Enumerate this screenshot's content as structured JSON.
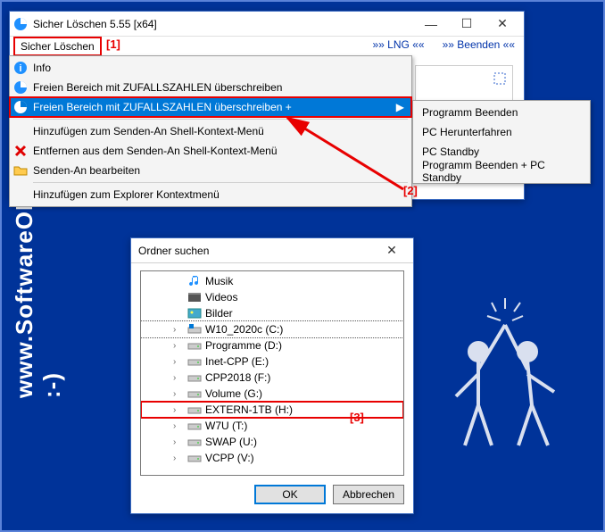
{
  "watermark": "www.SoftwareOK.de  :-)",
  "main_window": {
    "title": "Sicher Löschen 5.55 [x64]",
    "menu_button": "Sicher Löschen",
    "right_links": {
      "lng": "»» LNG ««",
      "beenden": "»» Beenden ««"
    }
  },
  "annotations": {
    "a1": "[1]",
    "a2": "[2]",
    "a3": "[3]"
  },
  "menu": {
    "items": [
      {
        "label": "Info",
        "icon": "info"
      },
      {
        "label": "Freien Bereich mit ZUFALLSZAHLEN überschreiben",
        "icon": "pie"
      },
      {
        "label": "Freien Bereich mit ZUFALLSZAHLEN überschreiben +",
        "icon": "pie",
        "selected": true,
        "submenu": true
      },
      {
        "sep": true
      },
      {
        "label": "Hinzufügen zum Senden-An Shell-Kontext-Menü",
        "icon": ""
      },
      {
        "label": "Entfernen aus dem Senden-An Shell-Kontext-Menü",
        "icon": "x"
      },
      {
        "label": "Senden-An bearbeiten",
        "icon": "folder"
      },
      {
        "sep": true
      },
      {
        "label": "Hinzufügen zum Explorer Kontextmenü",
        "icon": ""
      }
    ],
    "submenu": [
      "Programm Beenden",
      "PC Herunterfahren",
      "PC Standby",
      "Programm Beenden + PC Standby"
    ]
  },
  "browse": {
    "caption": "Ordner suchen",
    "items": [
      {
        "label": "Musik",
        "icon": "music",
        "indent": 2
      },
      {
        "label": "Videos",
        "icon": "video",
        "indent": 2
      },
      {
        "label": "Bilder",
        "icon": "pics",
        "indent": 2
      },
      {
        "label": "W10_2020c (C:)",
        "icon": "drive-win",
        "indent": 2,
        "expand": true,
        "sel": true
      },
      {
        "label": "Programme (D:)",
        "icon": "drive",
        "indent": 2,
        "expand": true
      },
      {
        "label": "Inet-CPP (E:)",
        "icon": "drive",
        "indent": 2,
        "expand": true
      },
      {
        "label": "CPP2018 (F:)",
        "icon": "drive",
        "indent": 2,
        "expand": true
      },
      {
        "label": "Volume (G:)",
        "icon": "drive",
        "indent": 2,
        "expand": true
      },
      {
        "label": "EXTERN-1TB (H:)",
        "icon": "drive",
        "indent": 2,
        "expand": true,
        "flag": true
      },
      {
        "label": "W7U (T:)",
        "icon": "drive",
        "indent": 2,
        "expand": true
      },
      {
        "label": "SWAP (U:)",
        "icon": "drive",
        "indent": 2,
        "expand": true
      },
      {
        "label": "VCPP (V:)",
        "icon": "drive",
        "indent": 2,
        "expand": true
      }
    ],
    "ok": "OK",
    "cancel": "Abbrechen"
  }
}
